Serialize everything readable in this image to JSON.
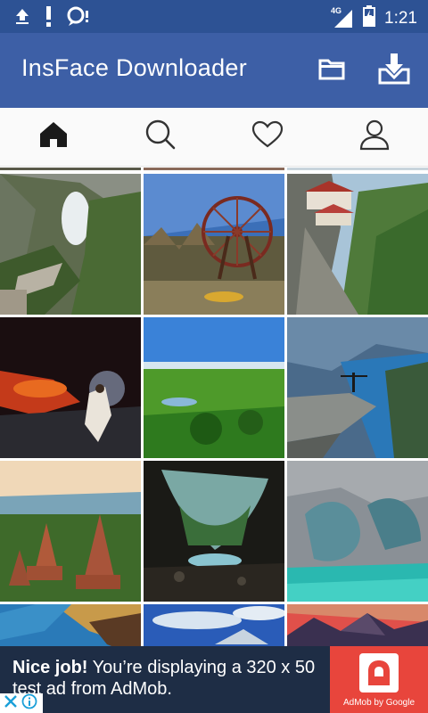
{
  "status_bar": {
    "time": "1:21",
    "network": "4G",
    "icons": [
      "upload-icon",
      "alert-icon",
      "notification-icon",
      "signal-icon",
      "battery-icon"
    ]
  },
  "app_bar": {
    "title": "InsFace Downloader",
    "actions": [
      "folder-icon",
      "download-icon"
    ]
  },
  "tabs": [
    {
      "name": "home",
      "icon": "home-icon",
      "active": true
    },
    {
      "name": "search",
      "icon": "search-icon",
      "active": false
    },
    {
      "name": "favorites",
      "icon": "heart-icon",
      "active": false
    },
    {
      "name": "profile",
      "icon": "person-icon",
      "active": false
    }
  ],
  "gallery": {
    "images": [
      {
        "scene": "mountain-arch-cave"
      },
      {
        "scene": "ferris-wheel"
      },
      {
        "scene": "cliff-monastery"
      },
      {
        "scene": "lava-night"
      },
      {
        "scene": "green-plain"
      },
      {
        "scene": "cliff-fjord"
      },
      {
        "scene": "temples-forest"
      },
      {
        "scene": "cave-opening"
      },
      {
        "scene": "marble-caves"
      },
      {
        "scene": "coast"
      },
      {
        "scene": "blue-sky-peak"
      },
      {
        "scene": "sunset-mountains"
      }
    ]
  },
  "ad": {
    "headline": "Nice job!",
    "body": "You’re displaying a 320 x 50 test ad from AdMob.",
    "brand": "AdMob by Google",
    "colors": {
      "background": "#1e2d45",
      "brand": "#e8453c"
    }
  },
  "colors": {
    "status_bar": "#2d5294",
    "app_bar": "#3d5fa6"
  }
}
